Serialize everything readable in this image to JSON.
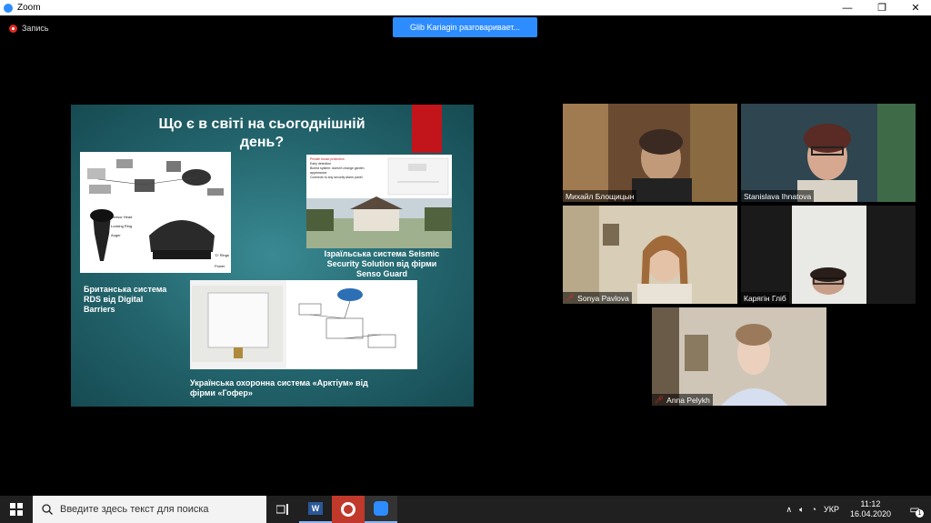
{
  "window": {
    "title": "Zoom",
    "minimize": "—",
    "maximize": "❐",
    "close": "✕"
  },
  "recording": {
    "label": "Запись"
  },
  "speaker_banner": {
    "text": "Glib Kariagin разговаривает..."
  },
  "slide": {
    "title_line1": "Що є в світі на сьогоднішній",
    "title_line2": "день?",
    "caption_british": [
      "Британська система",
      "RDS від Digital",
      "Barriers"
    ],
    "caption_israeli": [
      "Ізраїльська система Seismic",
      "Security Solution від фірми",
      "Senso Guard"
    ],
    "caption_ukrainian": [
      "Українська охоронна система «Арктіум» від",
      "фірми «Гофер»"
    ],
    "sensor_labels": [
      "Sensor Head",
      "Locking Ring",
      "Auger",
      "'O' Rings",
      "Power Plate"
    ],
    "private_box_title": "Private house protection",
    "private_box_items": [
      "Early detection",
      "Buried system: doesn't change garden appearance",
      "Connects to any security alarm panel"
    ],
    "colors": {
      "accent_red": "#c1151b",
      "slide_bg": "#23646c"
    }
  },
  "participants": [
    {
      "name": "Михайл Блощицын",
      "muted": false
    },
    {
      "name": "Stanislava Ihnatova",
      "muted": false
    },
    {
      "name": "Sonya Pavlova",
      "muted": true
    },
    {
      "name": "Карягін Гліб",
      "muted": false
    },
    {
      "name": "Anna Pelykh",
      "muted": true
    }
  ],
  "taskbar": {
    "search_placeholder": "Введите здесь текст для поиска",
    "lang": "УКР",
    "time": "11:12",
    "date": "16.04.2020",
    "notifications": "1"
  }
}
